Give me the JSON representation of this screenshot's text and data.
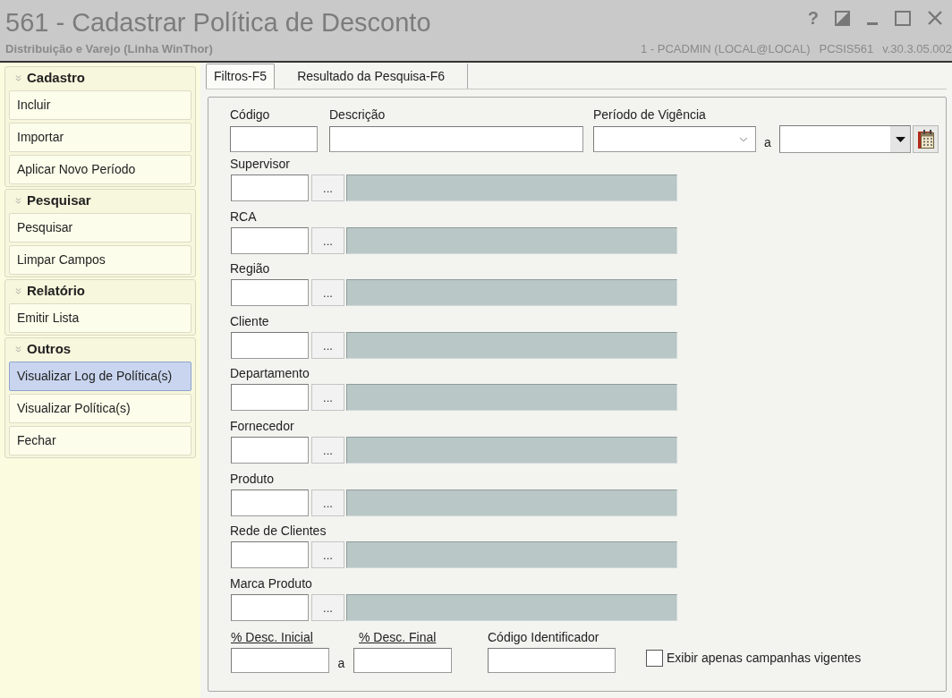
{
  "window": {
    "title": "561 - Cadastrar Política de Desconto",
    "subtitle": "Distribuição e Varejo (Linha WinThor)",
    "session": "1 - PCADMIN (LOCAL@LOCAL)",
    "program": "PCSIS561",
    "version": "v.30.3.05.002",
    "help": "?"
  },
  "sidebar": {
    "groups": [
      {
        "title": "Cadastro",
        "items": [
          {
            "label": "Incluir",
            "selected": false
          },
          {
            "label": "Importar",
            "selected": false
          },
          {
            "label": "Aplicar Novo Período",
            "selected": false
          }
        ]
      },
      {
        "title": "Pesquisar",
        "items": [
          {
            "label": "Pesquisar",
            "selected": false
          },
          {
            "label": "Limpar Campos",
            "selected": false
          }
        ]
      },
      {
        "title": "Relatório",
        "items": [
          {
            "label": "Emitir Lista",
            "selected": false
          }
        ]
      },
      {
        "title": "Outros",
        "items": [
          {
            "label": "Visualizar Log de Política(s)",
            "selected": true
          },
          {
            "label": "Visualizar Política(s)",
            "selected": false
          },
          {
            "label": "Fechar",
            "selected": false
          }
        ]
      }
    ]
  },
  "tabs": [
    {
      "label": "Filtros-F5",
      "selected": true
    },
    {
      "label": "Resultado da Pesquisa-F6",
      "selected": false
    }
  ],
  "filters": {
    "code": {
      "label": "Código"
    },
    "description": {
      "label": "Descrição"
    },
    "period": {
      "label": "Período de Vigência",
      "separator": "a"
    },
    "lookups": [
      {
        "label": "Supervisor",
        "button": "..."
      },
      {
        "label": "RCA",
        "button": "..."
      },
      {
        "label": "Região",
        "button": "..."
      },
      {
        "label": "Cliente",
        "button": "..."
      },
      {
        "label": "Departamento",
        "button": "..."
      },
      {
        "label": "Fornecedor",
        "button": "..."
      },
      {
        "label": "Produto",
        "button": "..."
      },
      {
        "label": "Rede de Clientes",
        "button": "..."
      },
      {
        "label": "Marca Produto",
        "button": "..."
      }
    ],
    "discount": {
      "from_label": "% Desc. Inicial",
      "separator": "a",
      "to_label": "% Desc. Final"
    },
    "identifier": {
      "label": "Código Identificador"
    },
    "only_current": {
      "label": "Exibir apenas campanhas vigentes",
      "checked": false
    }
  }
}
